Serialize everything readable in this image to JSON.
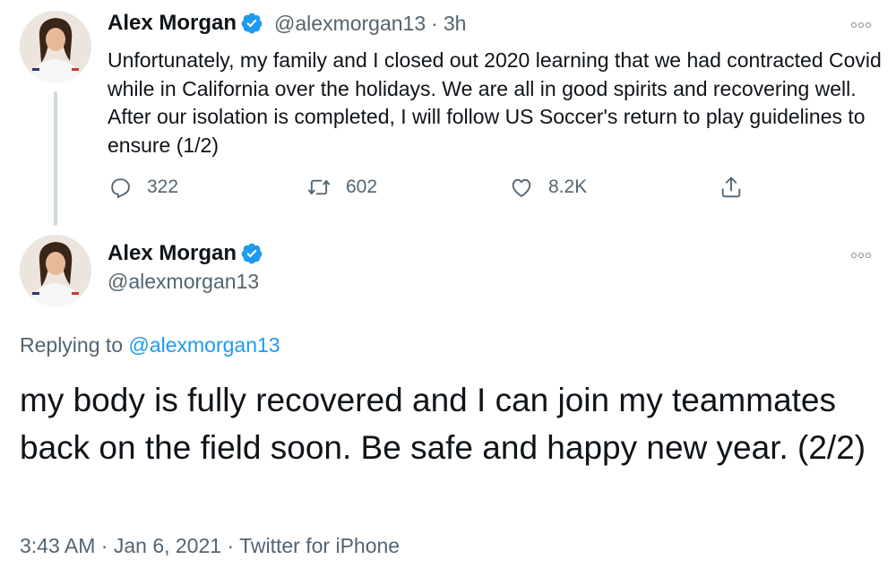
{
  "tweet1": {
    "author": {
      "display_name": "Alex Morgan",
      "handle": "@alexmorgan13",
      "verified_icon": "verified-badge-icon"
    },
    "separator": "·",
    "time_ago": "3h",
    "text": "Unfortunately, my family and I closed out 2020 learning that we had contracted Covid while in California over the holidays. We are all in good spirits and recovering well. After our isolation is completed, I will follow US Soccer's return to play guidelines to ensure (1/2)",
    "actions": {
      "reply": {
        "icon": "reply-icon",
        "count": "322"
      },
      "retweet": {
        "icon": "retweet-icon",
        "count": "602"
      },
      "like": {
        "icon": "heart-icon",
        "count": "8.2K"
      },
      "share": {
        "icon": "share-icon"
      }
    }
  },
  "tweet2": {
    "author": {
      "display_name": "Alex Morgan",
      "handle": "@alexmorgan13",
      "verified_icon": "verified-badge-icon"
    },
    "replying_prefix": "Replying to",
    "replying_handle": "@alexmorgan13",
    "text": "my body is fully recovered and I can join my teammates back on the field soon. Be safe and happy new year. (2/2)",
    "time": "3:43 AM",
    "date": "Jan 6, 2021",
    "source": "Twitter for iPhone",
    "meta_separator": "·"
  },
  "colors": {
    "text_primary": "#0f1419",
    "text_secondary": "#536471",
    "accent": "#1d9bf0",
    "thread_line": "#cfd9de"
  }
}
